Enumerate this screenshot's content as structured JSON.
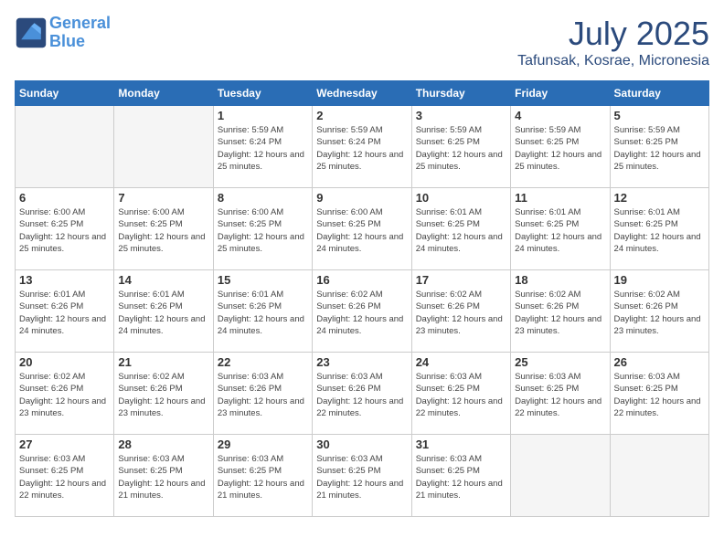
{
  "header": {
    "logo_line1": "General",
    "logo_line2": "Blue",
    "month_title": "July 2025",
    "location": "Tafunsak, Kosrae, Micronesia"
  },
  "weekdays": [
    "Sunday",
    "Monday",
    "Tuesday",
    "Wednesday",
    "Thursday",
    "Friday",
    "Saturday"
  ],
  "weeks": [
    [
      {
        "day": "",
        "empty": true
      },
      {
        "day": "",
        "empty": true
      },
      {
        "day": "1",
        "sunrise": "5:59 AM",
        "sunset": "6:24 PM",
        "daylight": "12 hours and 25 minutes."
      },
      {
        "day": "2",
        "sunrise": "5:59 AM",
        "sunset": "6:24 PM",
        "daylight": "12 hours and 25 minutes."
      },
      {
        "day": "3",
        "sunrise": "5:59 AM",
        "sunset": "6:25 PM",
        "daylight": "12 hours and 25 minutes."
      },
      {
        "day": "4",
        "sunrise": "5:59 AM",
        "sunset": "6:25 PM",
        "daylight": "12 hours and 25 minutes."
      },
      {
        "day": "5",
        "sunrise": "5:59 AM",
        "sunset": "6:25 PM",
        "daylight": "12 hours and 25 minutes."
      }
    ],
    [
      {
        "day": "6",
        "sunrise": "6:00 AM",
        "sunset": "6:25 PM",
        "daylight": "12 hours and 25 minutes."
      },
      {
        "day": "7",
        "sunrise": "6:00 AM",
        "sunset": "6:25 PM",
        "daylight": "12 hours and 25 minutes."
      },
      {
        "day": "8",
        "sunrise": "6:00 AM",
        "sunset": "6:25 PM",
        "daylight": "12 hours and 25 minutes."
      },
      {
        "day": "9",
        "sunrise": "6:00 AM",
        "sunset": "6:25 PM",
        "daylight": "12 hours and 24 minutes."
      },
      {
        "day": "10",
        "sunrise": "6:01 AM",
        "sunset": "6:25 PM",
        "daylight": "12 hours and 24 minutes."
      },
      {
        "day": "11",
        "sunrise": "6:01 AM",
        "sunset": "6:25 PM",
        "daylight": "12 hours and 24 minutes."
      },
      {
        "day": "12",
        "sunrise": "6:01 AM",
        "sunset": "6:25 PM",
        "daylight": "12 hours and 24 minutes."
      }
    ],
    [
      {
        "day": "13",
        "sunrise": "6:01 AM",
        "sunset": "6:26 PM",
        "daylight": "12 hours and 24 minutes."
      },
      {
        "day": "14",
        "sunrise": "6:01 AM",
        "sunset": "6:26 PM",
        "daylight": "12 hours and 24 minutes."
      },
      {
        "day": "15",
        "sunrise": "6:01 AM",
        "sunset": "6:26 PM",
        "daylight": "12 hours and 24 minutes."
      },
      {
        "day": "16",
        "sunrise": "6:02 AM",
        "sunset": "6:26 PM",
        "daylight": "12 hours and 24 minutes."
      },
      {
        "day": "17",
        "sunrise": "6:02 AM",
        "sunset": "6:26 PM",
        "daylight": "12 hours and 23 minutes."
      },
      {
        "day": "18",
        "sunrise": "6:02 AM",
        "sunset": "6:26 PM",
        "daylight": "12 hours and 23 minutes."
      },
      {
        "day": "19",
        "sunrise": "6:02 AM",
        "sunset": "6:26 PM",
        "daylight": "12 hours and 23 minutes."
      }
    ],
    [
      {
        "day": "20",
        "sunrise": "6:02 AM",
        "sunset": "6:26 PM",
        "daylight": "12 hours and 23 minutes."
      },
      {
        "day": "21",
        "sunrise": "6:02 AM",
        "sunset": "6:26 PM",
        "daylight": "12 hours and 23 minutes."
      },
      {
        "day": "22",
        "sunrise": "6:03 AM",
        "sunset": "6:26 PM",
        "daylight": "12 hours and 23 minutes."
      },
      {
        "day": "23",
        "sunrise": "6:03 AM",
        "sunset": "6:26 PM",
        "daylight": "12 hours and 22 minutes."
      },
      {
        "day": "24",
        "sunrise": "6:03 AM",
        "sunset": "6:25 PM",
        "daylight": "12 hours and 22 minutes."
      },
      {
        "day": "25",
        "sunrise": "6:03 AM",
        "sunset": "6:25 PM",
        "daylight": "12 hours and 22 minutes."
      },
      {
        "day": "26",
        "sunrise": "6:03 AM",
        "sunset": "6:25 PM",
        "daylight": "12 hours and 22 minutes."
      }
    ],
    [
      {
        "day": "27",
        "sunrise": "6:03 AM",
        "sunset": "6:25 PM",
        "daylight": "12 hours and 22 minutes."
      },
      {
        "day": "28",
        "sunrise": "6:03 AM",
        "sunset": "6:25 PM",
        "daylight": "12 hours and 21 minutes."
      },
      {
        "day": "29",
        "sunrise": "6:03 AM",
        "sunset": "6:25 PM",
        "daylight": "12 hours and 21 minutes."
      },
      {
        "day": "30",
        "sunrise": "6:03 AM",
        "sunset": "6:25 PM",
        "daylight": "12 hours and 21 minutes."
      },
      {
        "day": "31",
        "sunrise": "6:03 AM",
        "sunset": "6:25 PM",
        "daylight": "12 hours and 21 minutes."
      },
      {
        "day": "",
        "empty": true
      },
      {
        "day": "",
        "empty": true
      }
    ]
  ]
}
